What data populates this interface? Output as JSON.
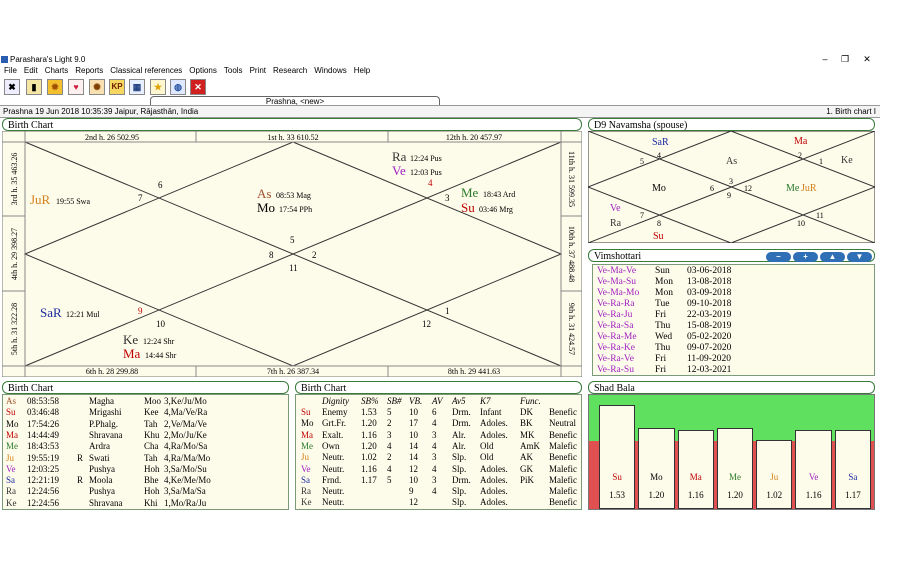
{
  "window": {
    "title": "Parashara's Light 9.0",
    "controls": {
      "minimize": "‒",
      "maximize": "❐",
      "close": "✕"
    }
  },
  "menu": [
    "File",
    "Edit",
    "Charts",
    "Reports",
    "Classical references",
    "Options",
    "Tools",
    "Print",
    "Research",
    "Windows",
    "Help"
  ],
  "toolbar_icons": [
    "exit-icon",
    "chart-icon",
    "sun-icon",
    "heart-icon",
    "wheel-icon",
    "kp-icon",
    "calendar-icon",
    "star-icon",
    "globe-icon",
    "close-icon"
  ],
  "toolbar_kp_label": "KP",
  "tab": {
    "label": "Prashna,  <new>"
  },
  "status": {
    "left": "Prashna 19 Jun 2018 10:35:39  Jaipur, Rājasthān, India",
    "right": "1. Birth chart I"
  },
  "birth_chart": {
    "title": "Birth Chart",
    "top_labels": [
      "2nd h.  26  502.95",
      "1st h.  33  610.52",
      "12th h.  20  457.97"
    ],
    "bottom_labels": [
      "6th h.  28  299.88",
      "7th h.  26  387.34",
      "8th h.  29  441.63"
    ],
    "left_labels": [
      "3rd h.  35  463.26",
      "4th h.  29  398.27",
      "5th h.  31  322.28"
    ],
    "right_labels": [
      "11th h.  31  599.35",
      "10th h.  37  488.48",
      "9th h.  31  424.57"
    ],
    "house_numbers": [
      "1",
      "2",
      "3",
      "4",
      "5",
      "6",
      "7",
      "8",
      "9",
      "10",
      "11",
      "12"
    ],
    "planets": {
      "ra": {
        "name": "Ra",
        "info": "12:24 Pus"
      },
      "ve": {
        "name": "Ve",
        "info": "12:03 Pus"
      },
      "as": {
        "name": "As",
        "info": "08:53 Mag"
      },
      "mo": {
        "name": "Mo",
        "info": "17:54 PPh"
      },
      "me": {
        "name": "Me",
        "info": "18:43 Ard"
      },
      "su": {
        "name": "Su",
        "info": "03:46 Mrg"
      },
      "ju": {
        "name": "JuR",
        "info": "19:55 Swa"
      },
      "sa": {
        "name": "SaR",
        "info": "12:21 Mul"
      },
      "ke": {
        "name": "Ke",
        "info": "12:24 Shr"
      },
      "ma": {
        "name": "Ma",
        "info": "14:44 Shr"
      }
    }
  },
  "navamsha": {
    "title": "D9 Navamsha  (spouse)",
    "planets": [
      "SaR",
      "Ma",
      "As",
      "Mo",
      "Me",
      "JuR",
      "Ve",
      "Ra",
      "Su",
      "Ke"
    ],
    "house_numbers": [
      "1",
      "2",
      "3",
      "4",
      "5",
      "6",
      "7",
      "8",
      "9",
      "10",
      "11",
      "12"
    ]
  },
  "vimshottari": {
    "title": "Vimshottari",
    "buttons": [
      "minus-icon",
      "plus-icon",
      "up-icon",
      "down-icon"
    ],
    "rows": [
      {
        "period": "Ve-Ma-Ve",
        "day": "Sun",
        "date": "03-06-2018"
      },
      {
        "period": "Ve-Ma-Su",
        "day": "Mon",
        "date": "13-08-2018"
      },
      {
        "period": "Ve-Ma-Mo",
        "day": "Mon",
        "date": "03-09-2018"
      },
      {
        "period": "Ve-Ra-Ra",
        "day": "Tue",
        "date": "09-10-2018"
      },
      {
        "period": "Ve-Ra-Ju",
        "day": "Fri",
        "date": "22-03-2019"
      },
      {
        "period": "Ve-Ra-Sa",
        "day": "Thu",
        "date": "15-08-2019"
      },
      {
        "period": "Ve-Ra-Me",
        "day": "Wed",
        "date": "05-02-2020"
      },
      {
        "period": "Ve-Ra-Ke",
        "day": "Thu",
        "date": "09-07-2020"
      },
      {
        "period": "Ve-Ra-Ve",
        "day": "Fri",
        "date": "11-09-2020"
      },
      {
        "period": "Ve-Ra-Su",
        "day": "Fri",
        "date": "12-03-2021"
      }
    ]
  },
  "birth_table_1": {
    "title": "Birth Chart",
    "rows": [
      [
        "As",
        "08:53:58",
        "",
        "Magha",
        "Moo",
        "3,Ke/Ju/Mo"
      ],
      [
        "Su",
        "03:46:48",
        "",
        "Mrigashi",
        "Kee",
        "4,Ma/Ve/Ra"
      ],
      [
        "Mo",
        "17:54:26",
        "",
        "P.Phalg.",
        "Tah",
        "2,Ve/Ma/Ve"
      ],
      [
        "Ma",
        "14:44:49",
        "",
        "Shravana",
        "Khu",
        "2,Mo/Ju/Ke"
      ],
      [
        "Me",
        "18:43:53",
        "",
        "Ardra",
        "Cha",
        "4,Ra/Mo/Sa"
      ],
      [
        "Ju",
        "19:55:19",
        "R",
        "Swati",
        "Tah",
        "4,Ra/Ma/Mo"
      ],
      [
        "Ve",
        "12:03:25",
        "",
        "Pushya",
        "Hoh",
        "3,Sa/Mo/Su"
      ],
      [
        "Sa",
        "12:21:19",
        "R",
        "Moola",
        "Bhe",
        "4,Ke/Me/Mo"
      ],
      [
        "Ra",
        "12:24:56",
        "",
        "Pushya",
        "Hoh",
        "3,Sa/Ma/Sa"
      ],
      [
        "Ke",
        "12:24:56",
        "",
        "Shravana",
        "Khi",
        "1,Mo/Ra/Ju"
      ]
    ]
  },
  "birth_table_2": {
    "title": "Birth Chart",
    "headers": [
      "",
      "Dignity",
      "SB%",
      "SB#",
      "VB.",
      "AV",
      "Av5",
      "K7",
      "Func."
    ],
    "rows": [
      [
        "Su",
        "Enemy",
        "1.53",
        "5",
        "10",
        "6",
        "Drm.",
        "Infant",
        "DK",
        "Benefic"
      ],
      [
        "Mo",
        "Grt.Fr.",
        "1.20",
        "2",
        "17",
        "4",
        "Drm.",
        "Adoles.",
        "BK",
        "Neutral"
      ],
      [
        "Ma",
        "Exalt.",
        "1.16",
        "3",
        "10",
        "3",
        "Alr.",
        "Adoles.",
        "MK",
        "Benefic"
      ],
      [
        "Me",
        "Own",
        "1.20",
        "4",
        "14",
        "4",
        "Alr.",
        "Old",
        "AmK",
        "Malefic"
      ],
      [
        "Ju",
        "Neutr.",
        "1.02",
        "2",
        "14",
        "3",
        "Slp.",
        "Old",
        "AK",
        "Benefic"
      ],
      [
        "Ve",
        "Neutr.",
        "1.16",
        "4",
        "12",
        "4",
        "Slp.",
        "Adoles.",
        "GK",
        "Malefic"
      ],
      [
        "Sa",
        "Frnd.",
        "1.17",
        "5",
        "10",
        "3",
        "Drm.",
        "Adoles.",
        "PiK",
        "Malefic"
      ],
      [
        "Ra",
        "Neutr.",
        "",
        "",
        "9",
        "4",
        "Slp.",
        "Adoles.",
        "",
        "Malefic"
      ],
      [
        "Ke",
        "Neutr.",
        "",
        "",
        "12",
        "",
        "Slp.",
        "Adoles.",
        "",
        "Benefic"
      ]
    ]
  },
  "shad_bala": {
    "title": "Shad Bala",
    "bars": [
      {
        "planet": "Su",
        "value": "1.53",
        "ratio": 1.53
      },
      {
        "planet": "Mo",
        "value": "1.20",
        "ratio": 1.2
      },
      {
        "planet": "Ma",
        "value": "1.16",
        "ratio": 1.16
      },
      {
        "planet": "Me",
        "value": "1.20",
        "ratio": 1.2
      },
      {
        "planet": "Ju",
        "value": "1.02",
        "ratio": 1.02
      },
      {
        "planet": "Ve",
        "value": "1.16",
        "ratio": 1.16
      },
      {
        "planet": "Sa",
        "value": "1.17",
        "ratio": 1.17
      }
    ],
    "colors": {
      "green": "#5fe05f",
      "red": "#e05050"
    }
  },
  "colors": {
    "Su": "#c00000",
    "Mo": "#000000",
    "Ma": "#c00000",
    "Me": "#2a7a2a",
    "Ju": "#d4801a",
    "Ve": "#a020c0",
    "Sa": "#1a2aa0",
    "Ra": "#333333",
    "Ke": "#333333",
    "As": "#a0522d"
  }
}
